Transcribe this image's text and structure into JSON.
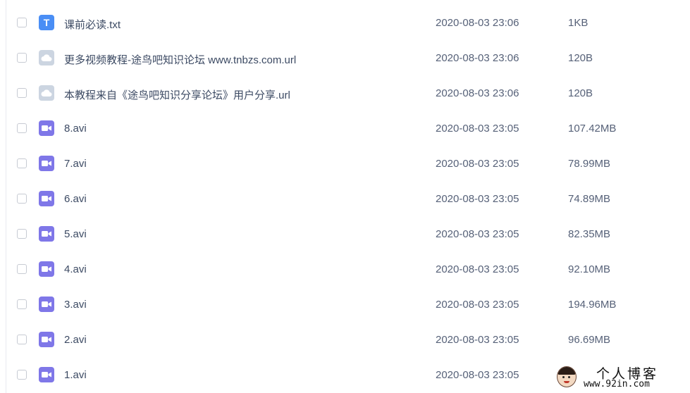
{
  "files": [
    {
      "name": "课前必读.txt",
      "type": "txt",
      "icon": "txt-file-icon",
      "date": "2020-08-03 23:06",
      "size": "1KB"
    },
    {
      "name": "更多视频教程-途鸟吧知识论坛 www.tnbzs.com.url",
      "type": "url",
      "icon": "url-file-icon",
      "date": "2020-08-03 23:06",
      "size": "120B"
    },
    {
      "name": "本教程来自《途鸟吧知识分享论坛》用户分享.url",
      "type": "url",
      "icon": "url-file-icon",
      "date": "2020-08-03 23:06",
      "size": "120B"
    },
    {
      "name": "8.avi",
      "type": "video",
      "icon": "video-file-icon",
      "date": "2020-08-03 23:05",
      "size": "107.42MB"
    },
    {
      "name": "7.avi",
      "type": "video",
      "icon": "video-file-icon",
      "date": "2020-08-03 23:05",
      "size": "78.99MB"
    },
    {
      "name": "6.avi",
      "type": "video",
      "icon": "video-file-icon",
      "date": "2020-08-03 23:05",
      "size": "74.89MB"
    },
    {
      "name": "5.avi",
      "type": "video",
      "icon": "video-file-icon",
      "date": "2020-08-03 23:05",
      "size": "82.35MB"
    },
    {
      "name": "4.avi",
      "type": "video",
      "icon": "video-file-icon",
      "date": "2020-08-03 23:05",
      "size": "92.10MB"
    },
    {
      "name": "3.avi",
      "type": "video",
      "icon": "video-file-icon",
      "date": "2020-08-03 23:05",
      "size": "194.96MB"
    },
    {
      "name": "2.avi",
      "type": "video",
      "icon": "video-file-icon",
      "date": "2020-08-03 23:05",
      "size": "96.69MB"
    },
    {
      "name": "1.avi",
      "type": "video",
      "icon": "video-file-icon",
      "date": "2020-08-03 23:05",
      "size": ""
    }
  ],
  "txt_icon_glyph": "T",
  "colors": {
    "txt_icon": "#4a8ef5",
    "url_icon": "#ccd5e1",
    "video_icon": "#7f77e8",
    "checkbox_border": "#c7cbd3"
  },
  "watermark": {
    "title": "个人博客",
    "url": "www.92in.com"
  }
}
